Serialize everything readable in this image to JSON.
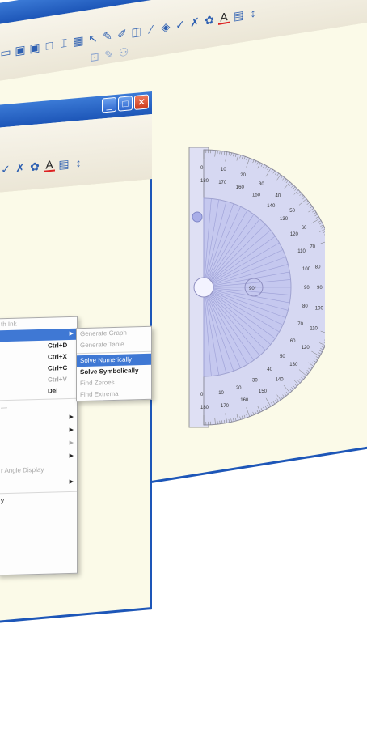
{
  "back_window": {
    "buttons": {
      "minimize": "_",
      "maximize": "□",
      "close": "✕"
    },
    "toolbar_icons": [
      "select-arrow-icon",
      "pen-icon",
      "highlighter-icon",
      "eraser-icon",
      "line-icon",
      "fill-icon",
      "marker-icon",
      "magic-pen-icon",
      "paint-icon",
      "text-icon",
      "font-color-icon",
      "spacing-icon"
    ]
  },
  "front_window": {
    "buttons": {
      "minimize": "_",
      "maximize": "□",
      "close": "✕"
    }
  },
  "protractor": {
    "outer_labels": [
      "0",
      "10",
      "20",
      "30",
      "40",
      "50",
      "60",
      "70",
      "80",
      "90",
      "100",
      "110",
      "120",
      "130",
      "140",
      "150",
      "160",
      "170",
      "180"
    ],
    "inner_labels": [
      "180",
      "170",
      "160",
      "150",
      "140",
      "130",
      "120",
      "110",
      "100",
      "90",
      "80",
      "70",
      "60",
      "50",
      "40",
      "30",
      "20",
      "10",
      "0"
    ],
    "angle_readout": "90°"
  },
  "context_menu": {
    "items": [
      {
        "label": "th Ink",
        "shortcut": "",
        "state": "disabled",
        "submenu": false
      },
      {
        "label": "",
        "shortcut": "",
        "state": "highlight",
        "submenu": true
      },
      {
        "label": "",
        "shortcut": "Ctrl+D",
        "state": "normal",
        "submenu": false
      },
      {
        "label": "",
        "shortcut": "Ctrl+X",
        "state": "normal",
        "submenu": false
      },
      {
        "label": "",
        "shortcut": "Ctrl+C",
        "state": "normal",
        "submenu": false
      },
      {
        "label": "",
        "shortcut": "Ctrl+V",
        "state": "disabled",
        "submenu": false
      },
      {
        "label": "",
        "shortcut": "Del",
        "state": "normal",
        "submenu": false
      },
      {
        "label": "—",
        "shortcut": "",
        "state": "disabled",
        "submenu": false
      },
      {
        "label": "",
        "shortcut": "",
        "state": "normal",
        "submenu": true
      },
      {
        "label": "",
        "shortcut": "",
        "state": "normal",
        "submenu": true
      },
      {
        "label": "",
        "shortcut": "",
        "state": "disabled",
        "submenu": true
      },
      {
        "label": "",
        "shortcut": "",
        "state": "normal",
        "submenu": true
      },
      {
        "label": "r Angle Display",
        "shortcut": "",
        "state": "disabled",
        "submenu": false
      },
      {
        "label": "",
        "shortcut": "",
        "state": "normal",
        "submenu": true
      },
      {
        "label": "y",
        "shortcut": "",
        "state": "normal",
        "submenu": false
      }
    ]
  },
  "submenu": {
    "items": [
      {
        "label": "Generate Graph",
        "state": "disabled"
      },
      {
        "label": "Generate Table",
        "state": "disabled"
      },
      {
        "label": "Solve Numerically",
        "state": "highlight"
      },
      {
        "label": "Solve Symbolically",
        "state": "bold"
      },
      {
        "label": "Find Zeroes",
        "state": "disabled"
      },
      {
        "label": "Find Extrema",
        "state": "disabled"
      }
    ]
  },
  "colors": {
    "title_blue": "#1d56b8",
    "highlight": "#3f78d4",
    "canvas": "#fbfae8",
    "protractor_fill": "#c5c8ef"
  }
}
